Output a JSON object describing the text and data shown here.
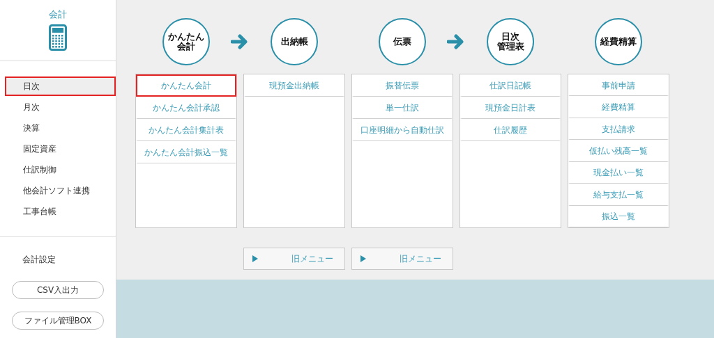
{
  "sidebar": {
    "title": "会計",
    "items": [
      {
        "label": "日次",
        "selected": true
      },
      {
        "label": "月次",
        "selected": false
      },
      {
        "label": "決算",
        "selected": false
      },
      {
        "label": "固定資産",
        "selected": false
      },
      {
        "label": "仕訳制御",
        "selected": false
      },
      {
        "label": "他会計ソフト連携",
        "selected": false
      },
      {
        "label": "工事台帳",
        "selected": false
      }
    ],
    "settings_link": "会計設定",
    "buttons": [
      "CSV入出力",
      "ファイル管理BOX"
    ]
  },
  "columns": [
    {
      "heading": [
        "かんたん",
        "会計"
      ],
      "arrow_after": true,
      "items": [
        {
          "label": "かんたん会計",
          "selected": true
        },
        {
          "label": "かんたん会計承認",
          "selected": false
        },
        {
          "label": "かんたん会計集計表",
          "selected": false
        },
        {
          "label": "かんたん会計振込一覧",
          "selected": false
        }
      ]
    },
    {
      "heading": [
        "出納帳"
      ],
      "arrow_after": false,
      "items": [
        {
          "label": "現預金出納帳",
          "selected": false
        }
      ],
      "old_menu_button": "旧メニュー"
    },
    {
      "heading": [
        "伝票"
      ],
      "arrow_after": true,
      "items": [
        {
          "label": "振替伝票",
          "selected": false
        },
        {
          "label": "単一仕訳",
          "selected": false
        },
        {
          "label": "口座明細から自動仕訳",
          "selected": false
        }
      ],
      "old_menu_button": "旧メニュー"
    },
    {
      "heading": [
        "日次",
        "管理表"
      ],
      "arrow_after": false,
      "items": [
        {
          "label": "仕訳日記帳",
          "selected": false
        },
        {
          "label": "現預金日計表",
          "selected": false
        },
        {
          "label": "仕訳履歴",
          "selected": false
        }
      ]
    },
    {
      "heading": [
        "経費精算"
      ],
      "arrow_after": false,
      "items": [
        {
          "label": "事前申請",
          "selected": false
        },
        {
          "label": "経費精算",
          "selected": false
        },
        {
          "label": "支払請求",
          "selected": false
        },
        {
          "label": "仮払い残高一覧",
          "selected": false
        },
        {
          "label": "現金払い一覧",
          "selected": false
        },
        {
          "label": "給与支払一覧",
          "selected": false
        },
        {
          "label": "振込一覧",
          "selected": false
        }
      ]
    }
  ]
}
